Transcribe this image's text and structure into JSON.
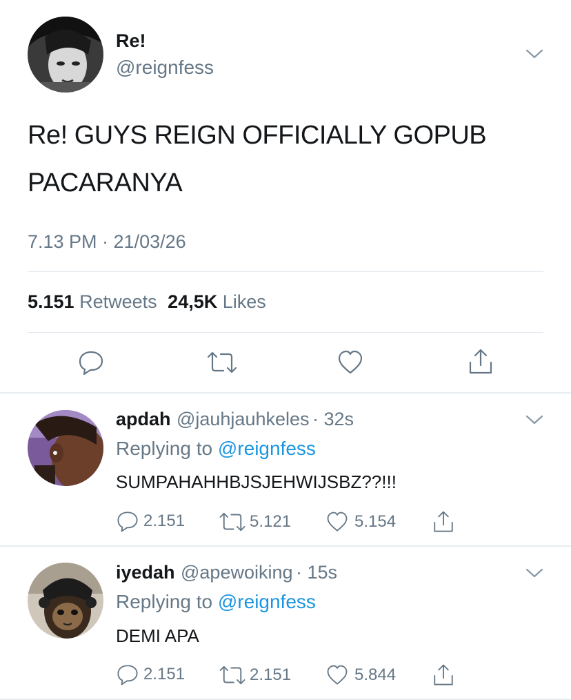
{
  "main_tweet": {
    "display_name": "Re!",
    "handle": "@reignfess",
    "text_line1": "Re! GUYS REIGN OFFICIALLY GOPUB",
    "text_line2": "PACARANYA",
    "timestamp": "7.13 PM · 21/03/26",
    "retweets_count": "5.151",
    "retweets_label": "Retweets",
    "likes_count": "24,5K",
    "likes_label": "Likes",
    "icons": [
      "reply-icon",
      "retweet-icon",
      "like-icon",
      "share-icon"
    ]
  },
  "replies": [
    {
      "display_name": "apdah",
      "handle": "@jauhjauhkeles",
      "time": "· 32s",
      "replying_label": "Replying to",
      "replying_to": "@reignfess",
      "text": "SUMPAHAHHBJSJEHWIJSBZ??!!!",
      "reply_count": "2.151",
      "retweet_count": "5.121",
      "like_count": "5.154"
    },
    {
      "display_name": "iyedah",
      "handle": "@apewoiking",
      "time": "· 15s",
      "replying_label": "Replying to",
      "replying_to": "@reignfess",
      "text": "DEMI APA",
      "reply_count": "2.151",
      "retweet_count": "2.151",
      "like_count": "5.844"
    }
  ],
  "colors": {
    "link": "#1b95e0",
    "secondary_text": "#657786",
    "primary_text": "#14171a",
    "divider": "#e1e8ed"
  }
}
